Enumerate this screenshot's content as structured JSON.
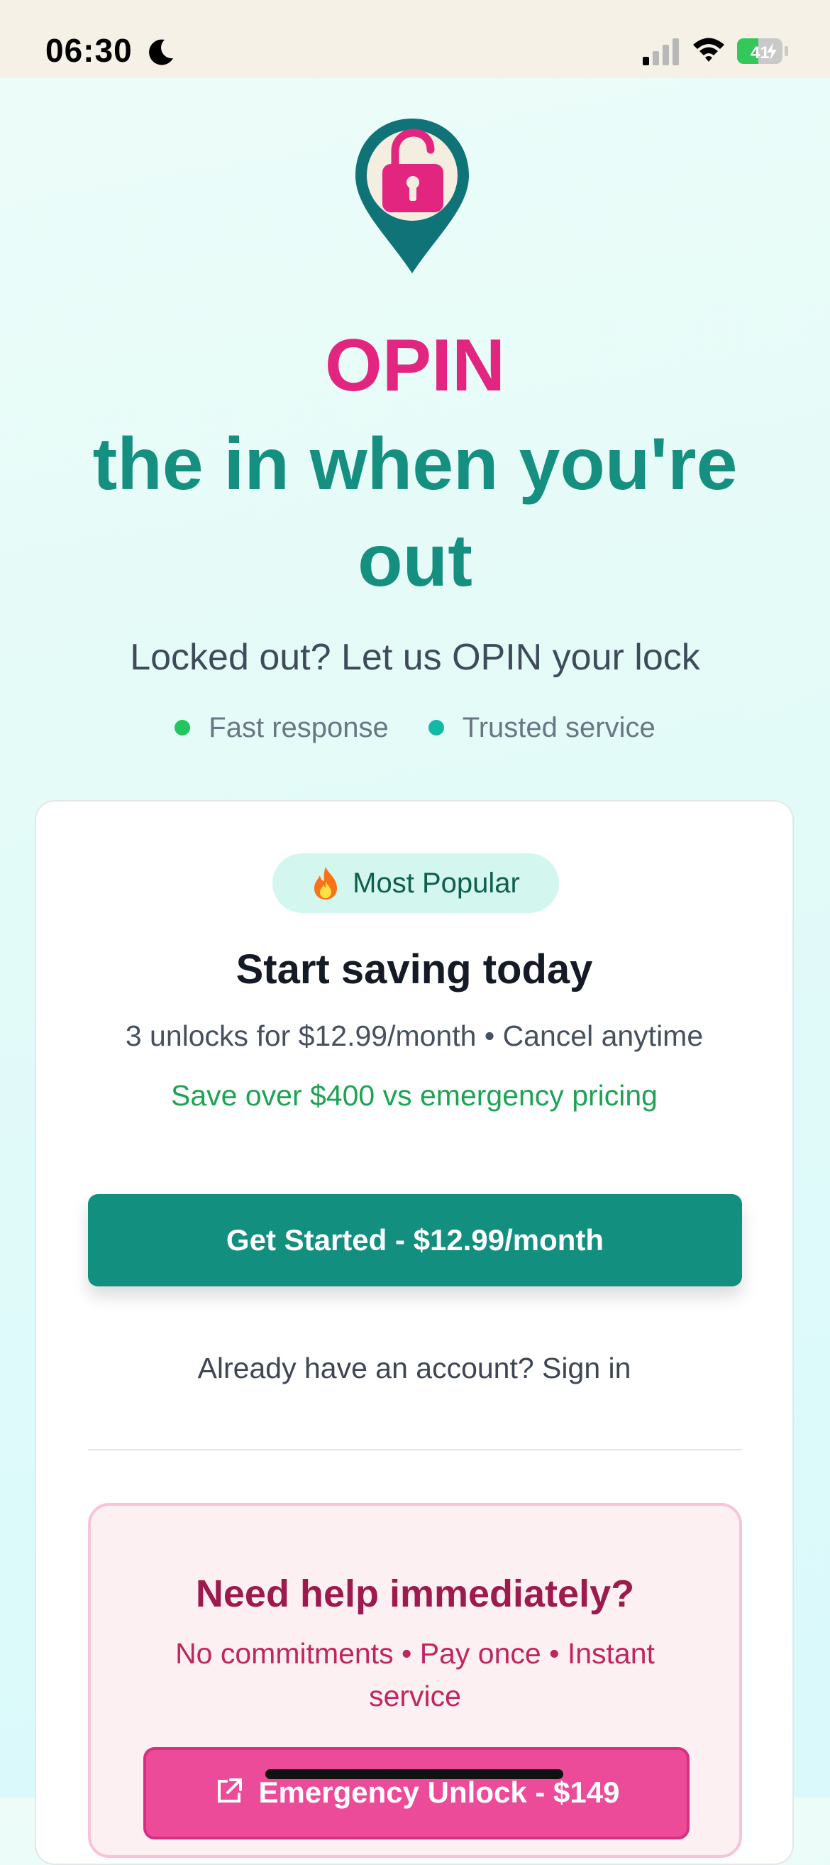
{
  "status_bar": {
    "time": "06:30",
    "battery": "41",
    "icons": [
      "moon-icon",
      "signal-icon",
      "wifi-icon",
      "battery-charging-icon"
    ]
  },
  "hero": {
    "logo_icon": "location-pin-unlock-icon",
    "brand": "OPIN",
    "tagline": "the in when you're out",
    "subtitle": "Locked out? Let us OPIN your lock",
    "features": [
      {
        "label": "Fast response",
        "color": "#22c55e"
      },
      {
        "label": "Trusted service",
        "color": "#14b8a6"
      }
    ]
  },
  "plan_card": {
    "badge_icon": "fire-icon",
    "badge_label": "Most Popular",
    "title": "Start saving today",
    "description": "3 unlocks for $12.99/month • Cancel anytime",
    "savings": "Save over $400 vs emergency pricing",
    "cta_label": "Get Started - $12.99/month",
    "signin_text": "Already have an account? Sign in"
  },
  "emergency": {
    "title": "Need help immediately?",
    "description": "No commitments • Pay once • Instant service",
    "button_icon": "external-link-icon",
    "button_label": "Emergency Unlock - $149"
  },
  "colors": {
    "brand_pink": "#e2267f",
    "brand_teal": "#148f80",
    "cta_teal": "#138f80",
    "emergency_pink": "#ec4b9a"
  }
}
